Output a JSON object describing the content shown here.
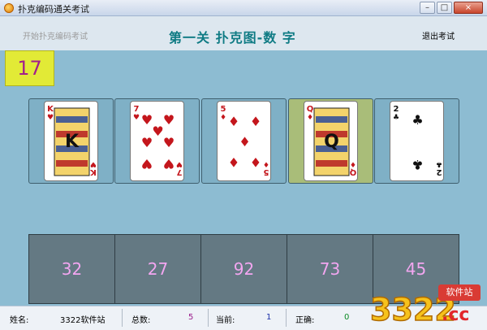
{
  "window": {
    "title": "扑克编码通关考试",
    "controls": {
      "minimize": "–",
      "maximize": "□",
      "close": "×"
    }
  },
  "header": {
    "start_button": "开始扑克编码考试",
    "stage_title": "第一关  扑克图-数  字",
    "exit_button": "退出考试"
  },
  "counter": "17",
  "cards": [
    {
      "rank": "K",
      "suit": "♥",
      "color": "#c4161c",
      "kind": "face"
    },
    {
      "rank": "7",
      "suit": "♥",
      "color": "#c4161c",
      "kind": "pip"
    },
    {
      "rank": "5",
      "suit": "♦",
      "color": "#c4161c",
      "kind": "pip"
    },
    {
      "rank": "Q",
      "suit": "♦",
      "color": "#c4161c",
      "kind": "face",
      "selected": true
    },
    {
      "rank": "2",
      "suit": "♣",
      "color": "#111111",
      "kind": "pip"
    }
  ],
  "answers": [
    "32",
    "27",
    "92",
    "73",
    "45"
  ],
  "status": {
    "name_label": "姓名:",
    "name_value": "3322软件站",
    "total_label": "总数:",
    "total_value": "5",
    "current_label": "当前:",
    "current_value": "1",
    "correct_label": "正确:",
    "correct_value": "0"
  },
  "watermark": {
    "text": "3322",
    "suffix": ".cc",
    "badge": "软件站"
  }
}
